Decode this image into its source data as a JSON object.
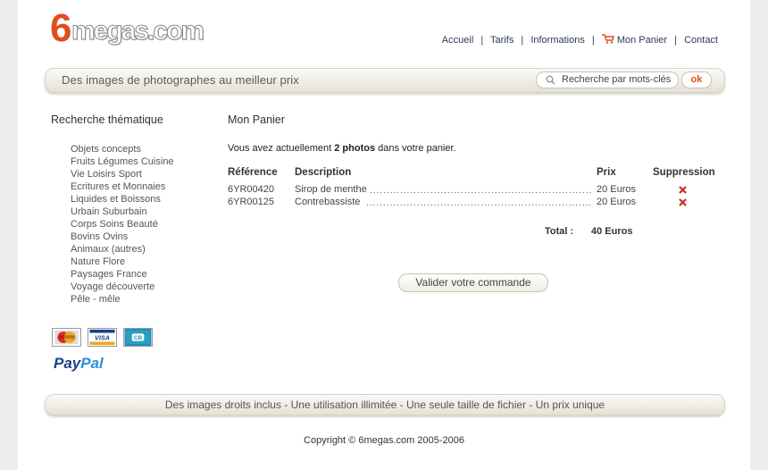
{
  "logo": {
    "six": "6",
    "rest": "megas.com"
  },
  "nav": {
    "items": [
      "Accueil",
      "Tarifs",
      "Informations",
      "Mon Panier",
      "Contact"
    ],
    "separator": "|"
  },
  "header": {
    "tagline": "Des images de photographes au meilleur prix",
    "search": {
      "placeholder": "Recherche par mots-clés",
      "value": ""
    },
    "ok_label": "ok"
  },
  "sidebar": {
    "title": "Recherche thématique",
    "categories": [
      "Objets concepts",
      "Fruits Légumes Cuisine",
      "Vie Loisirs Sport",
      "Ecritures et Monnaies",
      "Liquides et Boissons",
      "Urbain Suburbain",
      "Corps Soins Beauté",
      "Bovins Ovins",
      "Animaux (autres)",
      "Nature Flore",
      "Paysages France",
      "Voyage découverte",
      "Pêle - mêle"
    ],
    "payments": {
      "paypal_a": "Pay",
      "paypal_b": "Pal"
    }
  },
  "main": {
    "title": "Mon Panier",
    "summary_pre": "Vous avez actuellement ",
    "summary_bold": "2 photos",
    "summary_post": " dans votre panier.",
    "columns": {
      "reference": "Référence",
      "description": "Description",
      "price": "Prix",
      "delete": "Suppression"
    },
    "rows": [
      {
        "reference": "6YR00420",
        "description": "Sirop de menthe",
        "price": "20 Euros"
      },
      {
        "reference": "6YR00125",
        "description": "Contrebassiste",
        "price": "20 Euros"
      }
    ],
    "total_label": "Total :",
    "total_value": "40 Euros",
    "validate_label": "Valider votre commande"
  },
  "footer": {
    "slogan": "Des images droits inclus - Une utilisation illimitée - Une seule taille de fichier - Un prix unique",
    "copyright": "Copyright © 6megas.com 2005-2006"
  },
  "colors": {
    "accent": "#e04e1c",
    "nav_text": "#2b3a55",
    "bar_light": "#fbfaf7",
    "bar_dark": "#e5e1d6"
  }
}
